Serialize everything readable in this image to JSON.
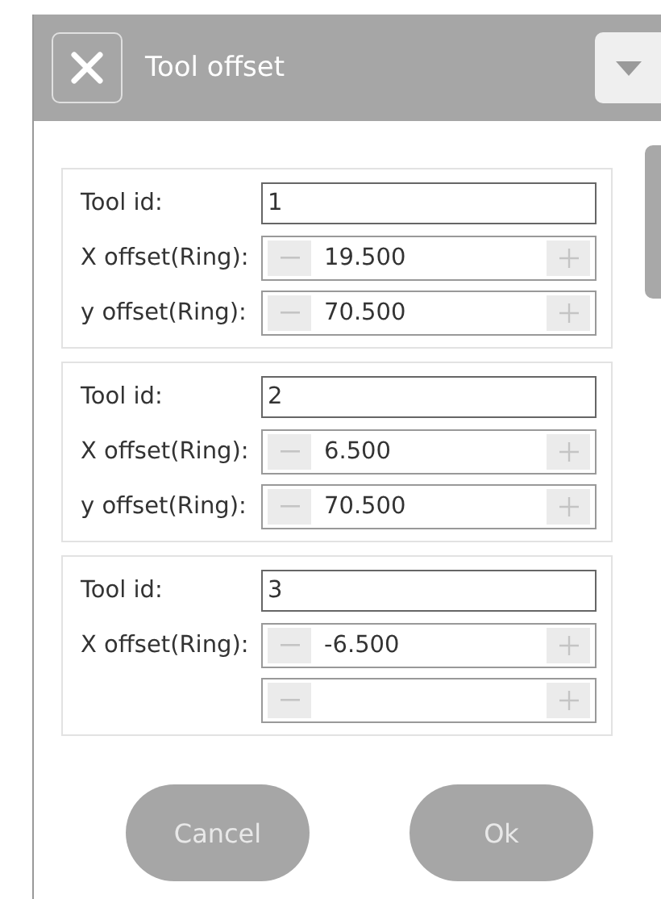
{
  "dialog": {
    "title": "Tool offset"
  },
  "tools": [
    {
      "rows": [
        {
          "kind": "text",
          "label": "Tool id:",
          "value": "1"
        },
        {
          "kind": "stepper",
          "label": "X offset(Ring):",
          "value": "19.500"
        },
        {
          "kind": "stepper",
          "label": "y offset(Ring):",
          "value": "70.500"
        }
      ]
    },
    {
      "rows": [
        {
          "kind": "text",
          "label": "Tool id:",
          "value": "2"
        },
        {
          "kind": "stepper",
          "label": "X offset(Ring):",
          "value": "6.500"
        },
        {
          "kind": "stepper",
          "label": "y offset(Ring):",
          "value": "70.500"
        }
      ]
    },
    {
      "rows": [
        {
          "kind": "text",
          "label": "Tool id:",
          "value": "3"
        },
        {
          "kind": "stepper",
          "label": "X offset(Ring):",
          "value": "-6.500"
        },
        {
          "kind": "stepper"
        }
      ]
    }
  ],
  "buttons": [
    "Cancel",
    "Ok"
  ]
}
